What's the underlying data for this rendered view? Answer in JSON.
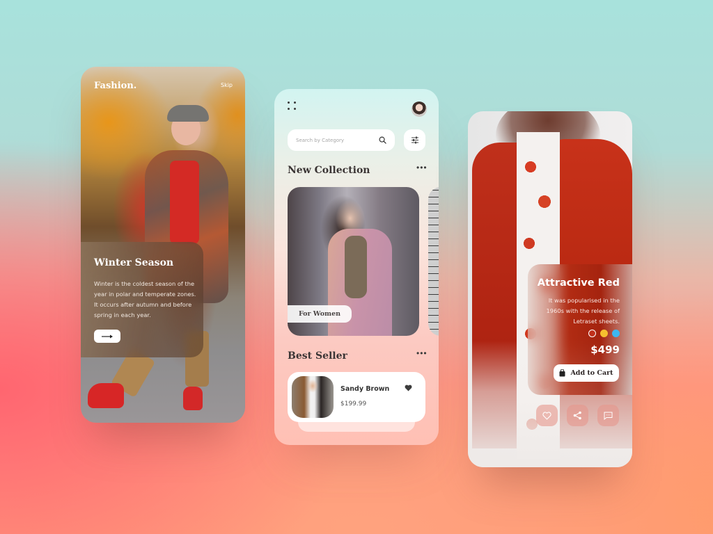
{
  "screens": {
    "onboarding": {
      "logo": "Fashion.",
      "skip_label": "Skip",
      "title": "Winter Season",
      "description": "Winter is the coldest season of the year in polar and temperate zones. It occurs after autumn and before spring in each year.",
      "next_icon": "arrow-right-icon"
    },
    "home": {
      "menu_icon": "grid-dots-icon",
      "avatar_icon": "user-avatar",
      "search": {
        "placeholder": "Search by Category",
        "icon": "search-icon"
      },
      "filter_icon": "sliders-icon",
      "new_collection": {
        "title": "New Collection",
        "more_icon": "more-dots-icon",
        "cards": [
          {
            "label": "For Women"
          }
        ]
      },
      "best_seller": {
        "title": "Best Seller",
        "more_icon": "more-dots-icon",
        "items": [
          {
            "name": "Sandy Brown",
            "price": "$199.99",
            "icon": "heart-icon"
          }
        ]
      }
    },
    "product": {
      "title": "Attractive Red",
      "description": "It was popularised in the 1960s with the release of Letraset sheets.",
      "color_options": [
        {
          "name": "red",
          "color": "#c0301b",
          "selected": true
        },
        {
          "name": "yellow",
          "color": "#f6c02f",
          "selected": false
        },
        {
          "name": "blue",
          "color": "#3db7f0",
          "selected": false
        }
      ],
      "price": "$499",
      "add_to_cart_label": "Add to Cart",
      "actions": [
        {
          "icon": "heart-icon"
        },
        {
          "icon": "share-icon"
        },
        {
          "icon": "chat-icon"
        }
      ]
    }
  }
}
